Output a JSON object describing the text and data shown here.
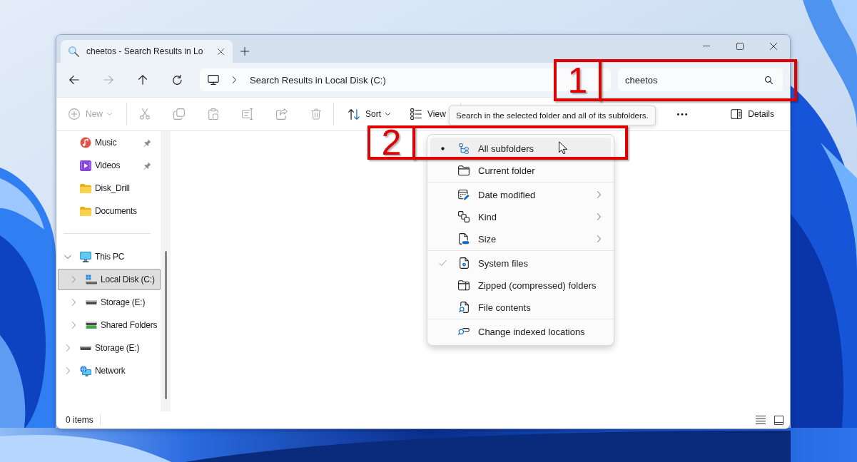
{
  "window": {
    "tabs": [
      {
        "title": "cheetos - Search Results in Lo",
        "selected": true
      }
    ]
  },
  "address_bar": {
    "nav_buttons": [
      {
        "disabled": false
      },
      {
        "disabled": true
      },
      {
        "disabled": false
      },
      {
        "disabled": false
      }
    ],
    "breadcrumbs": [
      "Search Results in Local Disk (C:)"
    ],
    "search": {
      "value": "cheetos"
    }
  },
  "command_bar": {
    "items": [
      {
        "kind": "button",
        "label": "New",
        "disabled": true,
        "dropdown": true
      },
      {
        "kind": "divider"
      },
      {
        "kind": "icon",
        "disabled": true
      },
      {
        "kind": "icon",
        "disabled": true
      },
      {
        "kind": "icon",
        "disabled": true
      },
      {
        "kind": "icon",
        "disabled": true
      },
      {
        "kind": "icon",
        "disabled": true
      },
      {
        "kind": "icon",
        "disabled": true
      },
      {
        "kind": "divider"
      },
      {
        "kind": "button",
        "label": "Sort",
        "disabled": false,
        "dropdown": true
      },
      {
        "kind": "button",
        "label": "View",
        "disabled": false,
        "dropdown": false
      },
      {
        "kind": "divider"
      }
    ],
    "right_items": [
      {
        "kind": "icon",
        "disabled": false
      },
      {
        "kind": "button",
        "label": "Details",
        "disabled": false,
        "dropdown": false
      }
    ]
  },
  "navigation_pane": {
    "pinned": [
      {
        "kind": "music",
        "label": "Music",
        "pinned": true,
        "selected": false
      },
      {
        "kind": "videos",
        "label": "Videos",
        "pinned": true,
        "selected": false
      },
      {
        "kind": "folder",
        "label": "Disk_Drill",
        "pinned": false,
        "selected": false
      },
      {
        "kind": "folder",
        "label": "Documents",
        "pinned": false,
        "selected": false
      }
    ],
    "tree": [
      {
        "kind": "pc",
        "label": "This PC",
        "expanded": true,
        "selected": false,
        "children": [
          {
            "kind": "system-drive",
            "label": "Local Disk (C:)",
            "expanded": false,
            "selected": true
          },
          {
            "kind": "drive",
            "label": "Storage (E:)",
            "expanded": false,
            "selected": false
          },
          {
            "kind": "network-drive",
            "label": "Shared Folders",
            "expanded": false,
            "selected": false
          }
        ]
      },
      {
        "kind": "drive",
        "label": "Storage (E:)",
        "expanded": false,
        "selected": false
      },
      {
        "kind": "network",
        "label": "Network",
        "expanded": false,
        "selected": false
      }
    ]
  },
  "status_bar": {
    "text": "0 items"
  },
  "tooltip": {
    "text": "Search in the selected folder and all of its subfolders."
  },
  "search_options_menu": {
    "sections": [
      {
        "items": [
          {
            "kind": "radio",
            "label": "All subfolders",
            "selected": true,
            "hovered": true
          },
          {
            "kind": "radio",
            "label": "Current folder",
            "selected": false,
            "hovered": false
          }
        ]
      },
      {
        "items": [
          {
            "kind": "submenu",
            "label": "Date modified",
            "hovered": false
          },
          {
            "kind": "submenu",
            "label": "Kind",
            "hovered": false
          },
          {
            "kind": "submenu",
            "label": "Size",
            "hovered": false
          }
        ]
      },
      {
        "items": [
          {
            "kind": "check",
            "label": "System files",
            "checked": true,
            "hovered": false
          },
          {
            "kind": "check",
            "label": "Zipped (compressed) folders",
            "checked": false,
            "hovered": false
          },
          {
            "kind": "check",
            "label": "File contents",
            "checked": false,
            "hovered": false
          }
        ]
      },
      {
        "items": [
          {
            "kind": "action",
            "label": "Change indexed locations",
            "hovered": false
          }
        ]
      }
    ]
  },
  "annotations": [
    {
      "label": "1"
    },
    {
      "label": "2"
    }
  ]
}
